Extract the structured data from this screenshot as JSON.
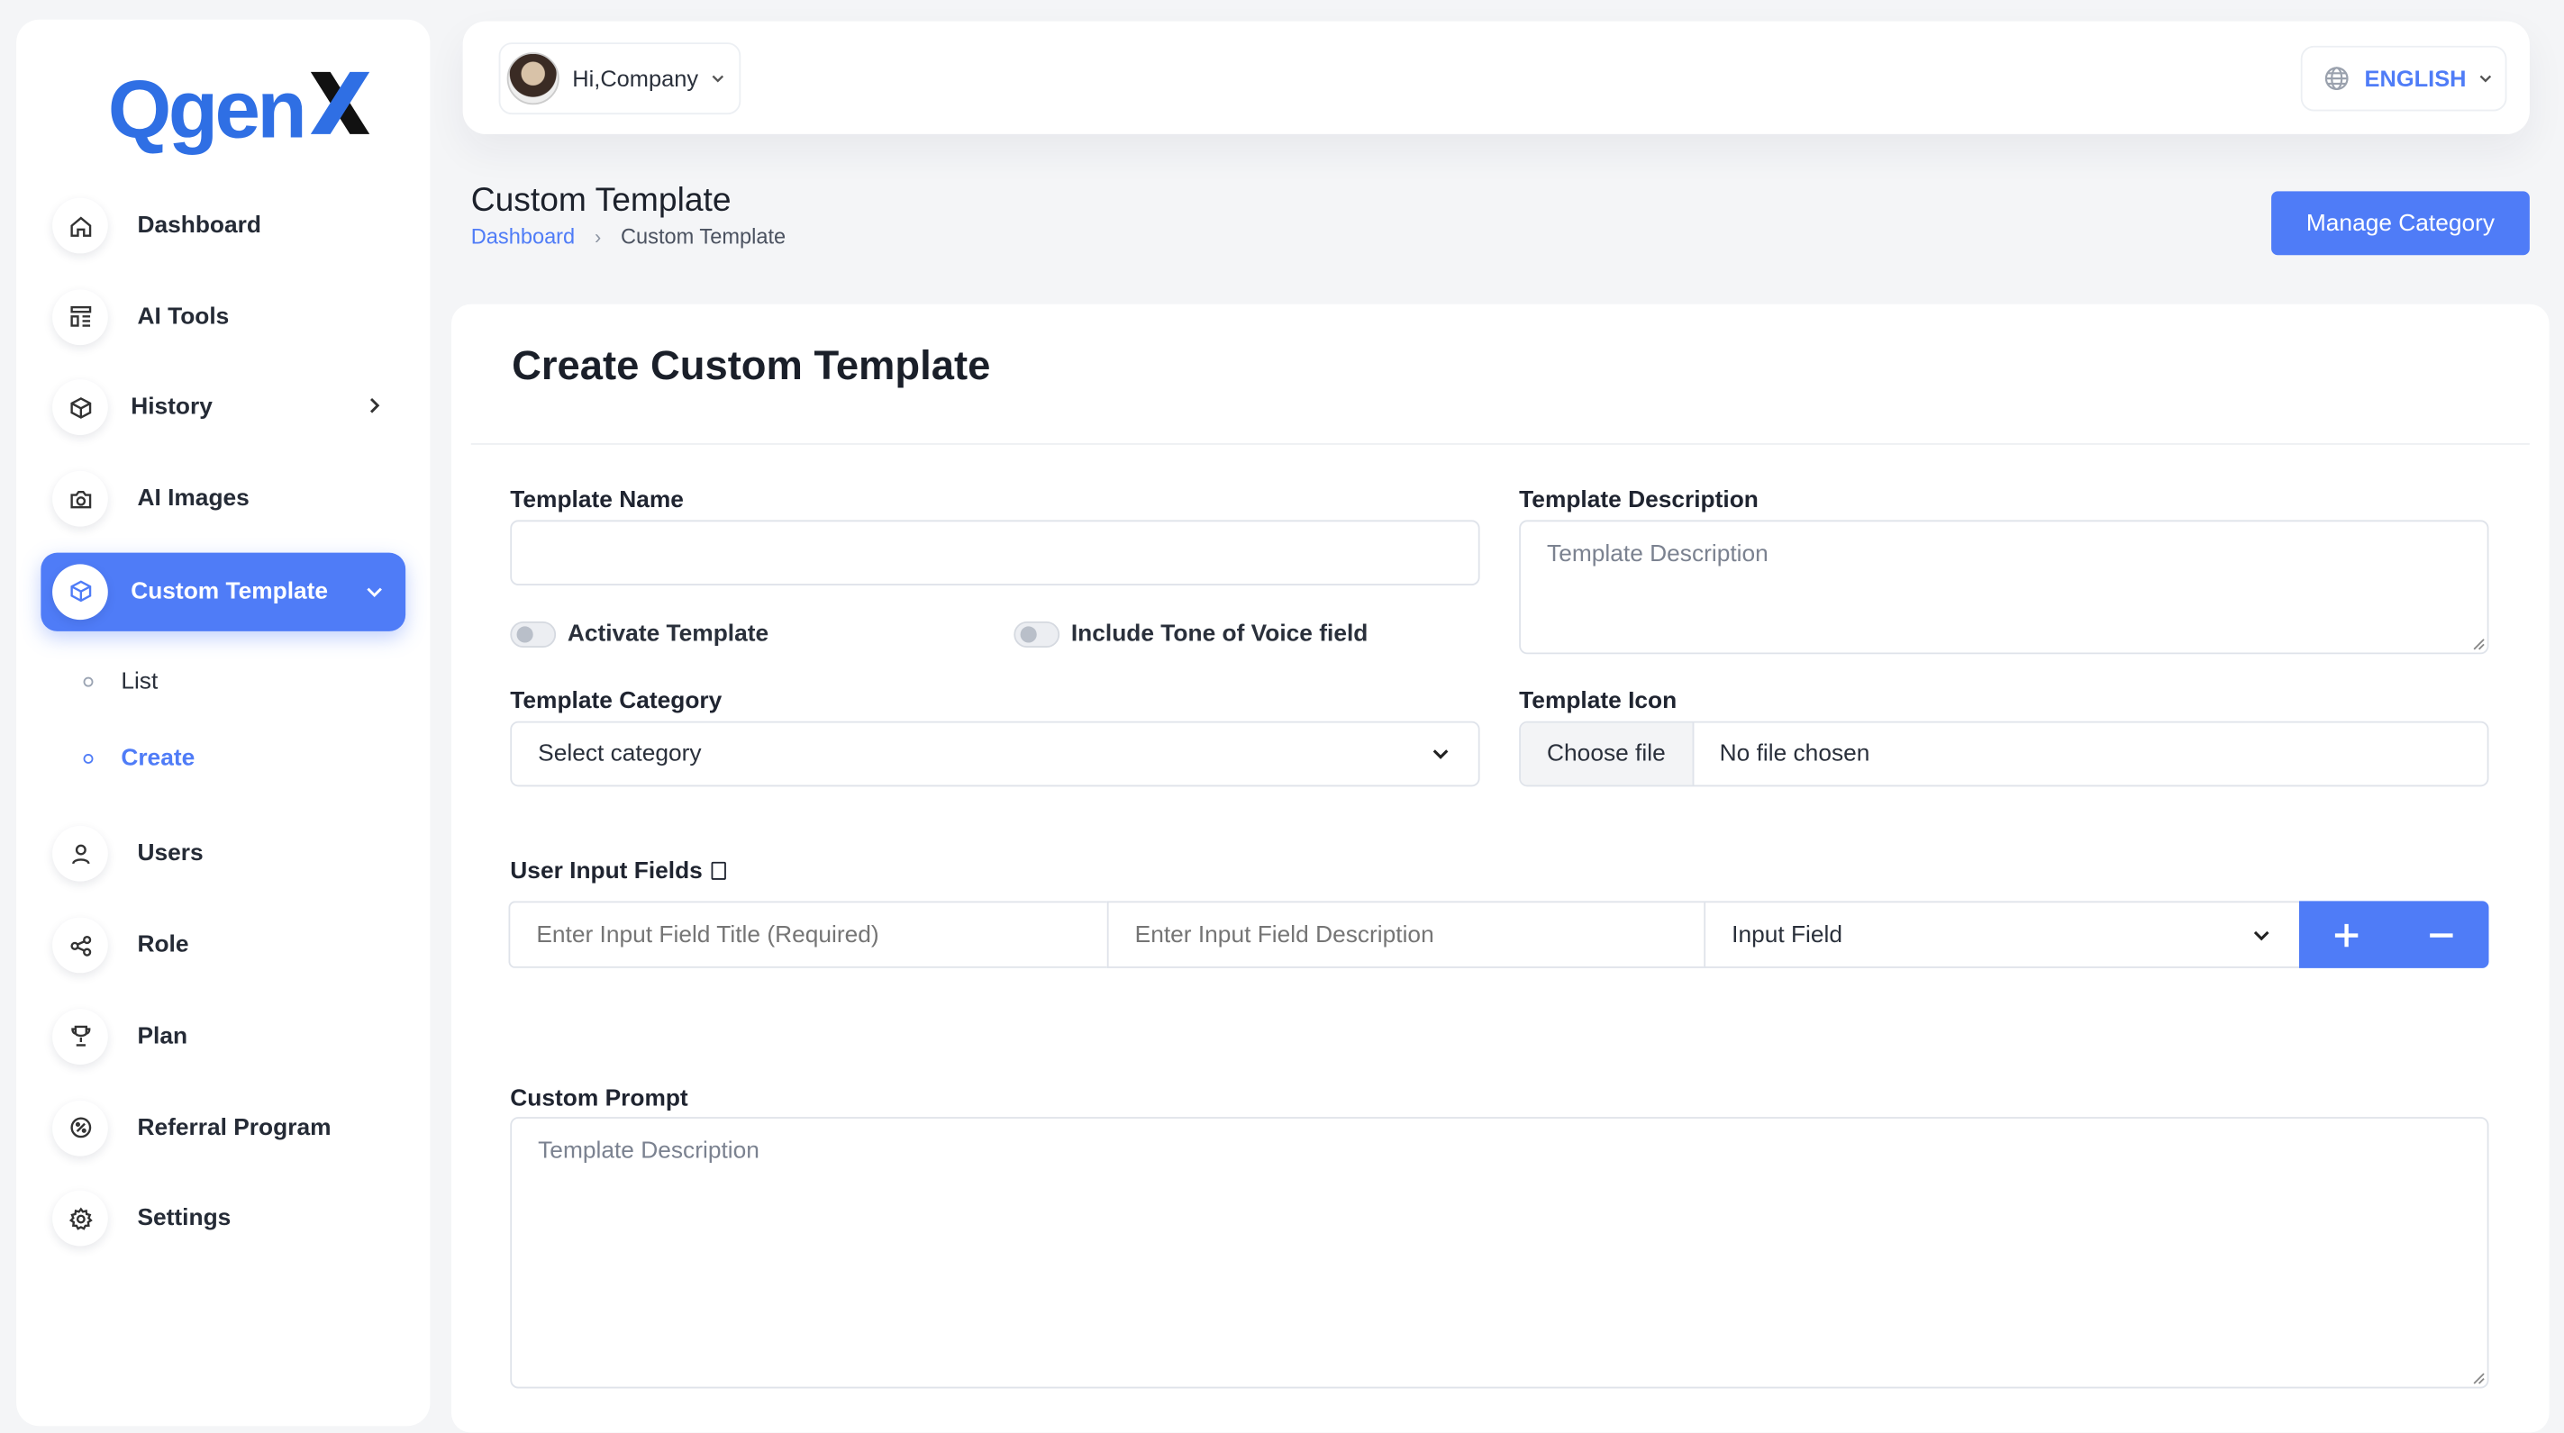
{
  "brand": {
    "logo_text": "Qgen",
    "logo_x": "X",
    "color": "#2f6fe4"
  },
  "sidebar": {
    "items": [
      {
        "label": "Dashboard",
        "icon": "home-icon"
      },
      {
        "label": "AI Tools",
        "icon": "layout-icon"
      },
      {
        "label": "History",
        "icon": "cube-icon"
      },
      {
        "label": "AI Images",
        "icon": "camera-icon"
      },
      {
        "label": "Custom Template",
        "icon": "cube-icon",
        "active": true
      },
      {
        "label": "Users",
        "icon": "user-icon"
      },
      {
        "label": "Role",
        "icon": "share-icon"
      },
      {
        "label": "Plan",
        "icon": "trophy-icon"
      },
      {
        "label": "Referral Program",
        "icon": "badge-percent-icon"
      },
      {
        "label": "Settings",
        "icon": "gear-icon"
      }
    ],
    "sub_items": [
      {
        "label": "List"
      },
      {
        "label": "Create",
        "current": true
      }
    ]
  },
  "topbar": {
    "greeting": "Hi,Company",
    "language": "ENGLISH"
  },
  "page": {
    "title": "Custom Template",
    "breadcrumb": {
      "home": "Dashboard",
      "current": "Custom Template"
    },
    "manage_button": "Manage Category"
  },
  "form": {
    "title": "Create Custom Template",
    "template_name": {
      "label": "Template Name",
      "value": "",
      "placeholder": ""
    },
    "template_description": {
      "label": "Template Description",
      "placeholder": "Template Description"
    },
    "activate_toggle": {
      "label": "Activate Template",
      "on": false
    },
    "tone_toggle": {
      "label": "Include Tone of Voice field",
      "on": false
    },
    "category": {
      "label": "Template Category",
      "value": "Select category"
    },
    "icon": {
      "label": "Template Icon",
      "button": "Choose file",
      "status": "No file chosen"
    },
    "user_input": {
      "label": "User Input Fields",
      "title_placeholder": "Enter Input Field Title (Required)",
      "description_placeholder": "Enter Input Field Description",
      "type_value": "Input Field"
    },
    "custom_prompt": {
      "label": "Custom Prompt",
      "placeholder": "Template Description"
    }
  },
  "colors": {
    "accent": "#4f7cf7",
    "background": "#f4f5f7"
  }
}
